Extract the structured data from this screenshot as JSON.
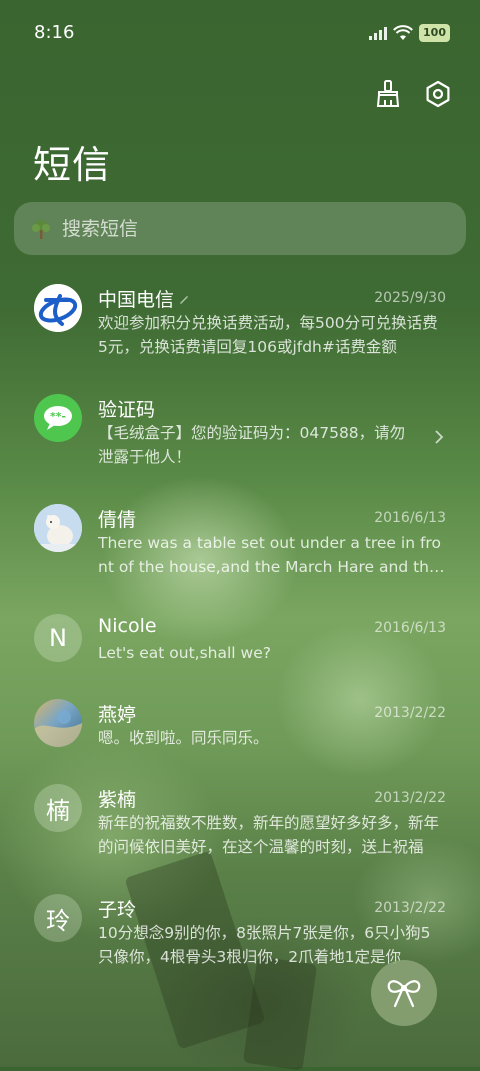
{
  "status_bar": {
    "time": "8:16",
    "battery": "100"
  },
  "header": {
    "title": "短信"
  },
  "search": {
    "placeholder": "搜索短信"
  },
  "conversations": [
    {
      "name": "中国电信",
      "date": "2025/9/30",
      "preview": "欢迎参加积分兑换话费活动，每500分可兑换话费5元，兑换话费请回复106或jfdh#话费金额"
    },
    {
      "name": "验证码",
      "date": "",
      "preview": "【毛绒盒子】您的验证码为：047588，请勿泄露于他人！"
    },
    {
      "name": "倩倩",
      "date": "2016/6/13",
      "preview": "There was a table set out under a tree in front of the house,and the March Hare and the Hatter"
    },
    {
      "name": "Nicole",
      "date": "2016/6/13",
      "preview": "Let's eat out,shall we?",
      "avatar_letter": "N"
    },
    {
      "name": "燕婷",
      "date": "2013/2/22",
      "preview": "嗯。收到啦。同乐同乐。"
    },
    {
      "name": "紫楠",
      "date": "2013/2/22",
      "preview": "新年的祝福数不胜数，新年的愿望好多好多，新年的问候依旧美好，在这个温馨的时刻，送上祝福",
      "avatar_letter": "楠"
    },
    {
      "name": "子玲",
      "date": "2013/2/22",
      "preview": "10分想念9别的你，8张照片7张是你，6只小狗5只像你，4根骨头3根归你，2爪着地1定是你",
      "avatar_letter": "玲"
    }
  ],
  "colors": {
    "background": "#3e6a33",
    "battery": "#cfe3a9",
    "telecom_blue": "#1d5fc8",
    "wechat_green": "#4fc74f"
  },
  "icons": {
    "clean": "broom-icon",
    "settings": "settings-icon",
    "search": "tree-icon",
    "fab": "bow-icon"
  }
}
